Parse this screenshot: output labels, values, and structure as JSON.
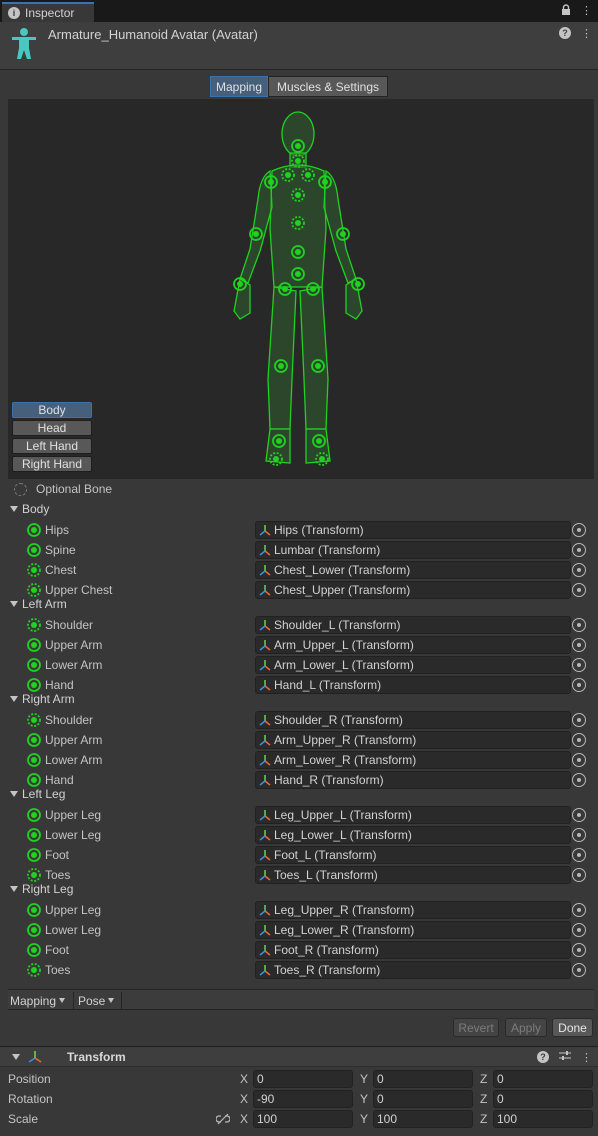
{
  "tab": {
    "label": "Inspector"
  },
  "header": {
    "title": "Armature_Humanoid Avatar (Avatar)"
  },
  "mode_toggle": {
    "mapping": "Mapping",
    "muscles": "Muscles & Settings",
    "active": "Mapping"
  },
  "body_parts": [
    "Body",
    "Head",
    "Left Hand",
    "Right Hand"
  ],
  "active_body_part": "Body",
  "legend": {
    "optional_bone": "Optional Bone"
  },
  "groups": [
    {
      "name": "Body",
      "bones": [
        {
          "label": "Hips",
          "value": "Hips (Transform)",
          "optional": false
        },
        {
          "label": "Spine",
          "value": "Lumbar (Transform)",
          "optional": false
        },
        {
          "label": "Chest",
          "value": "Chest_Lower (Transform)",
          "optional": true
        },
        {
          "label": "Upper Chest",
          "value": "Chest_Upper (Transform)",
          "optional": true
        }
      ]
    },
    {
      "name": "Left Arm",
      "bones": [
        {
          "label": "Shoulder",
          "value": "Shoulder_L (Transform)",
          "optional": true
        },
        {
          "label": "Upper Arm",
          "value": "Arm_Upper_L (Transform)",
          "optional": false
        },
        {
          "label": "Lower Arm",
          "value": "Arm_Lower_L (Transform)",
          "optional": false
        },
        {
          "label": "Hand",
          "value": "Hand_L (Transform)",
          "optional": false
        }
      ]
    },
    {
      "name": "Right Arm",
      "bones": [
        {
          "label": "Shoulder",
          "value": "Shoulder_R (Transform)",
          "optional": true
        },
        {
          "label": "Upper Arm",
          "value": "Arm_Upper_R (Transform)",
          "optional": false
        },
        {
          "label": "Lower Arm",
          "value": "Arm_Lower_R (Transform)",
          "optional": false
        },
        {
          "label": "Hand",
          "value": "Hand_R (Transform)",
          "optional": false
        }
      ]
    },
    {
      "name": "Left Leg",
      "bones": [
        {
          "label": "Upper Leg",
          "value": "Leg_Upper_L (Transform)",
          "optional": false
        },
        {
          "label": "Lower Leg",
          "value": "Leg_Lower_L (Transform)",
          "optional": false
        },
        {
          "label": "Foot",
          "value": "Foot_L (Transform)",
          "optional": false
        },
        {
          "label": "Toes",
          "value": "Toes_L (Transform)",
          "optional": true
        }
      ]
    },
    {
      "name": "Right Leg",
      "bones": [
        {
          "label": "Upper Leg",
          "value": "Leg_Upper_R (Transform)",
          "optional": false
        },
        {
          "label": "Lower Leg",
          "value": "Leg_Lower_R (Transform)",
          "optional": false
        },
        {
          "label": "Foot",
          "value": "Foot_R (Transform)",
          "optional": false
        },
        {
          "label": "Toes",
          "value": "Toes_R (Transform)",
          "optional": true
        }
      ]
    }
  ],
  "toolbar": {
    "mapping": "Mapping",
    "pose": "Pose"
  },
  "actions": {
    "revert": "Revert",
    "apply": "Apply",
    "done": "Done"
  },
  "transform": {
    "title": "Transform",
    "rows": [
      {
        "label": "Position",
        "x": "0",
        "y": "0",
        "z": "0"
      },
      {
        "label": "Rotation",
        "x": "-90",
        "y": "0",
        "z": "0"
      },
      {
        "label": "Scale",
        "x": "100",
        "y": "100",
        "z": "100"
      }
    ],
    "axes": [
      "X",
      "Y",
      "Z"
    ]
  },
  "colors": {
    "bone_green": "#1fd21f",
    "accent_blue": "#3a72b0",
    "active_button": "#46607c"
  },
  "icons": {
    "tab": "info-icon",
    "lock": "lock-icon",
    "menu": "kebab-menu-icon",
    "avatar": "humanoid-avatar-icon",
    "transform": "transform-axes-icon",
    "picker": "object-picker-icon",
    "help": "help-icon",
    "presets": "presets-icon",
    "link": "constrained-proportions-icon"
  }
}
